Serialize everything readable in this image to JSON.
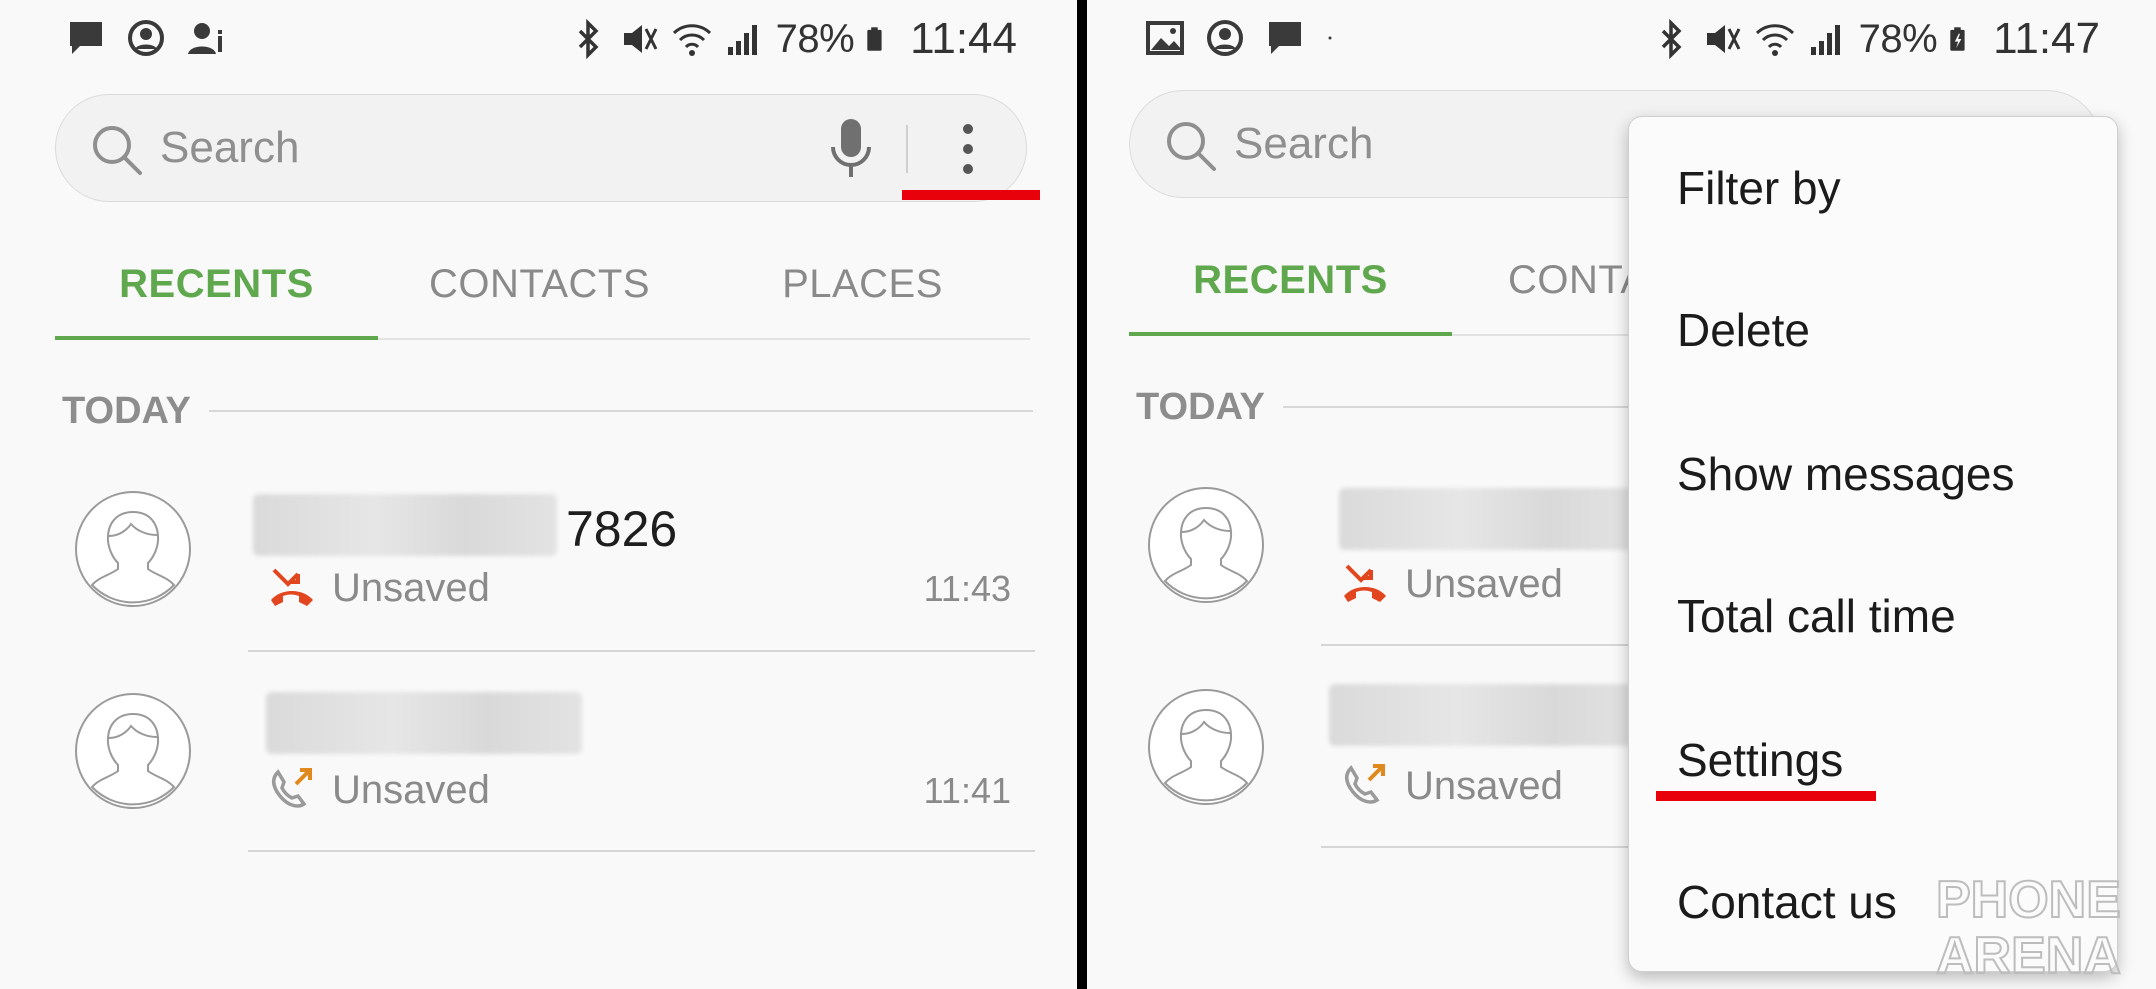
{
  "left": {
    "status": {
      "battery": "78%",
      "time": "11:44"
    },
    "search": {
      "placeholder": "Search"
    },
    "tabs": [
      {
        "label": "RECENTS",
        "active": true
      },
      {
        "label": "CONTACTS",
        "active": false
      },
      {
        "label": "PLACES",
        "active": false
      }
    ],
    "section": "TODAY",
    "calls": [
      {
        "name_suffix": "7826",
        "type": "missed",
        "label": "Unsaved",
        "time": "11:43"
      },
      {
        "name_suffix": "",
        "type": "outgoing",
        "label": "Unsaved",
        "time": "11:41"
      }
    ]
  },
  "right": {
    "status": {
      "battery": "78%",
      "time": "11:47"
    },
    "search": {
      "placeholder": "Search"
    },
    "tabs": [
      {
        "label": "RECENTS",
        "active": true
      },
      {
        "label": "CONTA",
        "active": false
      }
    ],
    "section": "TODAY",
    "calls": [
      {
        "type": "missed",
        "label": "Unsaved"
      },
      {
        "type": "outgoing",
        "label": "Unsaved"
      }
    ],
    "menu": {
      "items": [
        "Filter by",
        "Delete",
        "Show messages",
        "Total call time",
        "Settings",
        "Contact us"
      ],
      "highlighted": "Settings"
    }
  },
  "watermark": {
    "line1": "PHONE",
    "line2": "ARENA"
  },
  "colors": {
    "accent_green": "#5fa84e",
    "highlight_red": "#e8000a",
    "missed_call": "#e2461f",
    "outgoing_arrow": "#e08a1e"
  }
}
